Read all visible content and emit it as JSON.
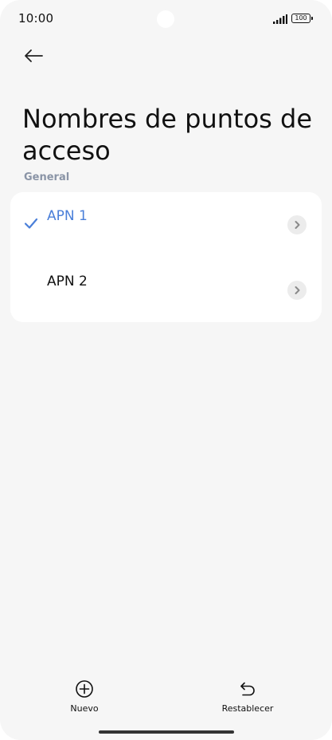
{
  "status_bar": {
    "time": "10:00",
    "battery": "100",
    "icons": [
      "signal-icon",
      "battery-icon"
    ]
  },
  "header": {
    "back_icon": "arrow-left-icon",
    "title": "Nombres de puntos de acceso"
  },
  "section": {
    "label": "General"
  },
  "apn_list": {
    "items": [
      {
        "label": "APN 1",
        "selected": true
      },
      {
        "label": "APN 2",
        "selected": false
      }
    ]
  },
  "bottom_bar": {
    "new_label": "Nuevo",
    "new_icon": "plus-circle-icon",
    "reset_label": "Restablecer",
    "reset_icon": "undo-icon"
  },
  "colors": {
    "accent": "#4a7fd9",
    "background": "#f6f6f6",
    "card": "#ffffff",
    "section_label": "#8a94a6"
  }
}
